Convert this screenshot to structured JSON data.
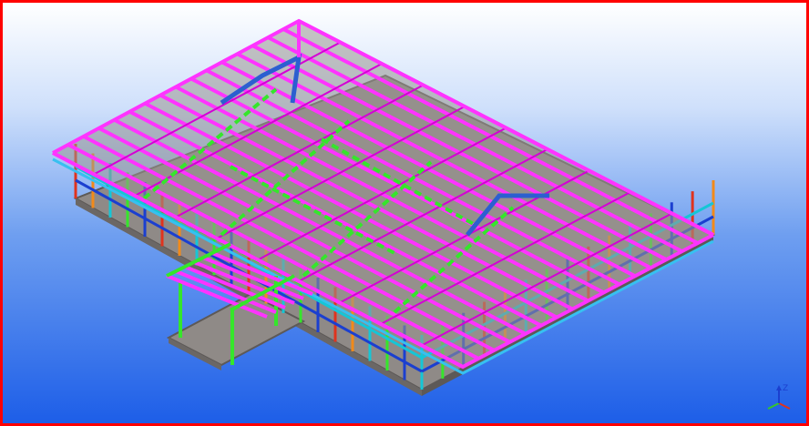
{
  "viewport": {
    "frame_color": "#ff0000",
    "background_top": "#ffffff",
    "background_bottom": "#1d5ee8"
  },
  "model": {
    "icons": {
      "roof_frame": "magenta-rafter-lines",
      "ridge": "blue-ridge-beam",
      "bracing": "green-diagonal-bracing",
      "deck": "grey-floor-slab",
      "walls": "colored-wall-studs"
    },
    "colors": {
      "rafter": "#ff33ff",
      "purlin": "#d400d4",
      "bracing": "#35e62b",
      "ridge": "#2c5fd0",
      "deck": "#8f8a87",
      "deck_edge": "#5d5957",
      "wall_red": "#e0331d",
      "wall_orange": "#f28a1a",
      "wall_cyan": "#15c6d6",
      "wall_blue": "#1b3fd0",
      "eave_tile": "#37c0f0"
    }
  },
  "axis_triad": {
    "z_label": "Z",
    "x_color": "#e0331d",
    "y_color": "#35c62b",
    "z_color": "#1b3fd0"
  }
}
